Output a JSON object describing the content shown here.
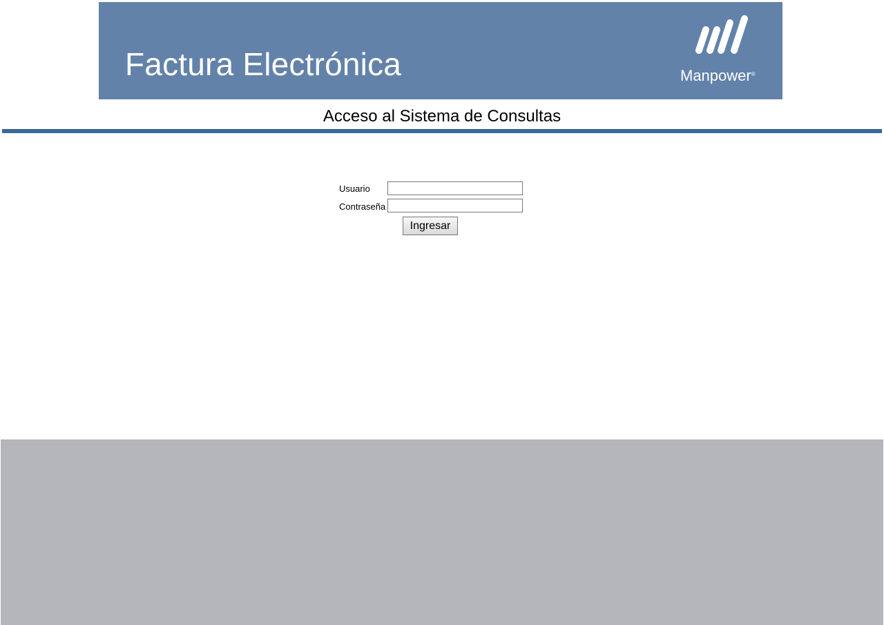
{
  "header": {
    "title": "Factura Electrónica",
    "brand": "Manpower",
    "brand_mark": "®",
    "logo_icon": "manpower-logo-icon",
    "background_color": "#6282aa"
  },
  "page": {
    "subtitle": "Acceso al Sistema de Consultas",
    "rule_color": "#3a6796"
  },
  "login": {
    "username_label": "Usuario",
    "username_value": "",
    "password_label": "Contraseña",
    "password_value": "",
    "submit_label": "Ingresar"
  },
  "footer": {
    "background_color": "#b5b6bb"
  }
}
